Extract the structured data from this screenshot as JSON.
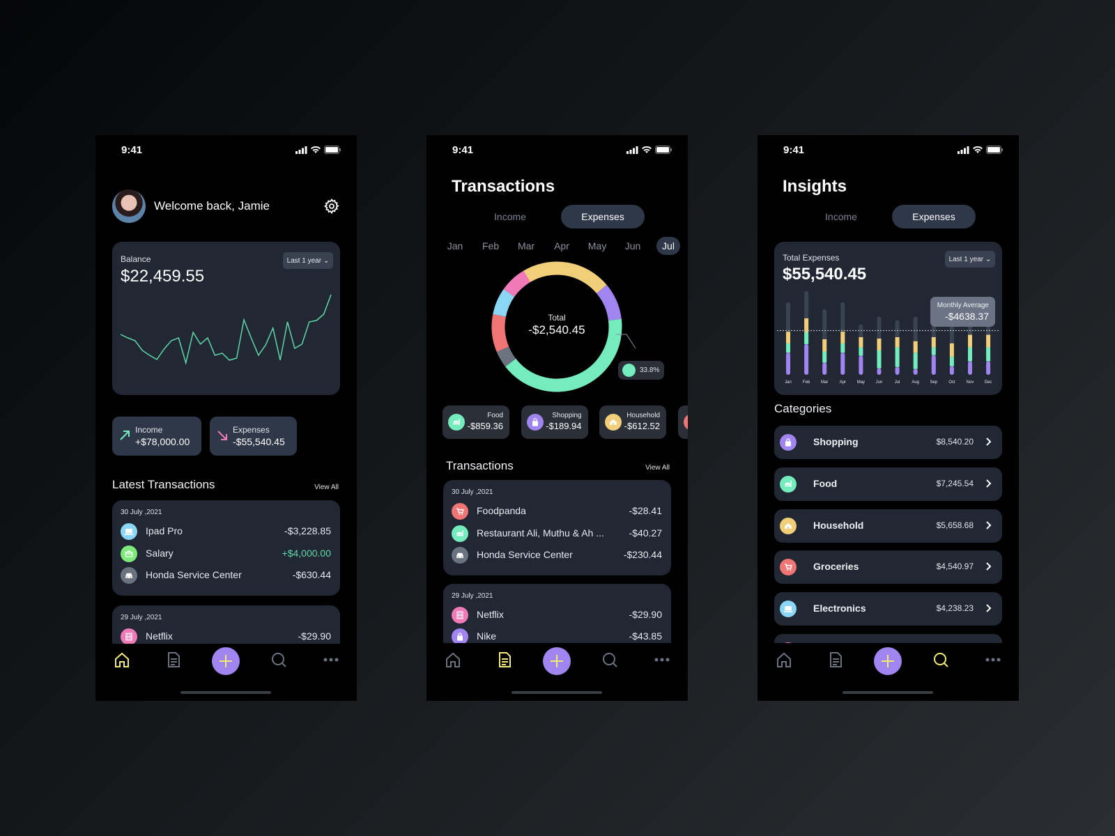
{
  "status": {
    "time": "9:41"
  },
  "home": {
    "welcome": "Welcome back, Jamie",
    "balance": {
      "label": "Balance",
      "amount": "$22,459.55",
      "range": "Last 1 year",
      "trend_levels": [
        43,
        38,
        34,
        20,
        13,
        7,
        22,
        34,
        38,
        2,
        46,
        29,
        38,
        13,
        16,
        6,
        9,
        64,
        38,
        13,
        28,
        52,
        6,
        61,
        23,
        29,
        61,
        63,
        72,
        100
      ],
      "line_color": "#5fd9a8"
    },
    "income": {
      "label": "Income",
      "amount": "+$78,000.00"
    },
    "expenses": {
      "label": "Expenses",
      "amount": "-$55,540.45"
    },
    "latest_title": "Latest Transactions",
    "view_all": "View All",
    "groups": [
      {
        "date": "30 July ,2021",
        "items": [
          {
            "name": "Ipad Pro",
            "amount": "-$3,228.85",
            "icon": "laptop-icon",
            "color": "#8bd5f5"
          },
          {
            "name": "Salary",
            "amount": "+$4,000.00",
            "icon": "briefcase-icon",
            "color": "#7ee87a",
            "positive": true
          },
          {
            "name": "Honda Service Center",
            "amount": "-$630.44",
            "icon": "car-icon",
            "color": "#6b7380"
          }
        ]
      },
      {
        "date": "29 July ,2021",
        "items": [
          {
            "name": "Netflix",
            "amount": "-$29.90",
            "icon": "film-icon",
            "color": "#f07ab8"
          }
        ]
      }
    ]
  },
  "transactions": {
    "title": "Transactions",
    "toggle": {
      "income": "Income",
      "expenses": "Expenses",
      "selected": "Expenses"
    },
    "months": [
      "Jan",
      "Feb",
      "Mar",
      "Apr",
      "May",
      "Jun",
      "Jul"
    ],
    "selected_month": "Jul",
    "donut": {
      "total_label": "Total",
      "total": "-$2,540.45",
      "start_angle_deg": -31,
      "slices": [
        {
          "share": 22.5,
          "color": "#f1cf7a"
        },
        {
          "share": 9.2,
          "color": "#a084f0"
        },
        {
          "share": 41.4,
          "color": "#74ecbe"
        },
        {
          "share": 4.2,
          "color": "#6b7380"
        },
        {
          "share": 9.4,
          "color": "#f07575"
        },
        {
          "share": 6.7,
          "color": "#8bd5f5"
        },
        {
          "share": 6.7,
          "color": "#f07ab8"
        }
      ],
      "callout": "33.8%"
    },
    "chips": [
      {
        "label": "Food",
        "amount": "-$859.36",
        "icon": "food-icon",
        "color": "#74ecbe"
      },
      {
        "label": "Shopping",
        "amount": "-$189.94",
        "icon": "shopping-bag-icon",
        "color": "#a084f0"
      },
      {
        "label": "Household",
        "amount": "-$612.52",
        "icon": "house-icon",
        "color": "#f1cf7a"
      },
      {
        "label": "",
        "amount": "",
        "icon": "cart-icon",
        "color": "#f07575"
      }
    ],
    "list_title": "Transactions",
    "view_all": "View All",
    "groups": [
      {
        "date": "30 July ,2021",
        "items": [
          {
            "name": "Foodpanda",
            "amount": "-$28.41",
            "icon": "cart-icon",
            "color": "#f07575"
          },
          {
            "name": "Restaurant Ali, Muthu & Ah ...",
            "amount": "-$40.27",
            "icon": "food-icon",
            "color": "#74ecbe"
          },
          {
            "name": "Honda Service Center",
            "amount": "-$230.44",
            "icon": "car-icon",
            "color": "#6b7380"
          }
        ]
      },
      {
        "date": "29 July ,2021",
        "items": [
          {
            "name": "Netflix",
            "amount": "-$29.90",
            "icon": "film-icon",
            "color": "#f07ab8"
          },
          {
            "name": "Nike",
            "amount": "-$43.85",
            "icon": "shopping-bag-icon",
            "color": "#a084f0"
          }
        ]
      }
    ]
  },
  "insights": {
    "title": "Insights",
    "toggle": {
      "income": "Income",
      "expenses": "Expenses",
      "selected": "Expenses"
    },
    "total_label": "Total Expenses",
    "total": "$55,540.45",
    "range": "Last 1 year",
    "chart_data": {
      "type": "bar",
      "stacked": true,
      "categories": [
        "Jan",
        "Feb",
        "Mar",
        "Apr",
        "May",
        "Jun",
        "Jul",
        "Aug",
        "Sep",
        "Oct",
        "Nov",
        "Dec"
      ],
      "series": [
        {
          "values": [
            2320,
            3220,
            1270,
            2320,
            2000,
            680,
            830,
            610,
            2070,
            900,
            1420,
            1420
          ],
          "color": "#a084f0"
        },
        {
          "values": [
            980,
            1240,
            1170,
            980,
            880,
            1880,
            2050,
            1710,
            810,
            980,
            1460,
            1460
          ],
          "color": "#74ecbe"
        },
        {
          "values": [
            1220,
            1460,
            1290,
            1220,
            1070,
            1240,
            1070,
            1200,
            1070,
            1420,
            1320,
            1320
          ],
          "color": "#f1cf7a"
        }
      ],
      "track_values": [
        7610,
        8780,
        6880,
        7610,
        5290,
        6100,
        5730,
        6100,
        6100,
        5860,
        6100,
        6100
      ],
      "ylim": [
        0,
        9500
      ],
      "average": 4638.37,
      "average_label": "Monthly Average",
      "average_value": "-$4638.37"
    },
    "categories_title": "Categories",
    "categories": [
      {
        "name": "Shopping",
        "amount": "$8,540.20",
        "icon": "shopping-bag-icon",
        "color": "#a084f0"
      },
      {
        "name": "Food",
        "amount": "$7,245.54",
        "icon": "food-icon",
        "color": "#74ecbe"
      },
      {
        "name": "Household",
        "amount": "$5,658.68",
        "icon": "house-icon",
        "color": "#f1cf7a"
      },
      {
        "name": "Groceries",
        "amount": "$4,540.97",
        "icon": "cart-icon",
        "color": "#f07575"
      },
      {
        "name": "Electronics",
        "amount": "$4,238.23",
        "icon": "laptop-icon",
        "color": "#8bd5f5"
      },
      {
        "name": "",
        "amount": "",
        "icon": "film-icon",
        "color": "#f07ab8"
      }
    ]
  },
  "nav": {
    "active_color": "#f3ec72",
    "inactive_color": "#6b7380",
    "plus_color": "#a084f0"
  }
}
